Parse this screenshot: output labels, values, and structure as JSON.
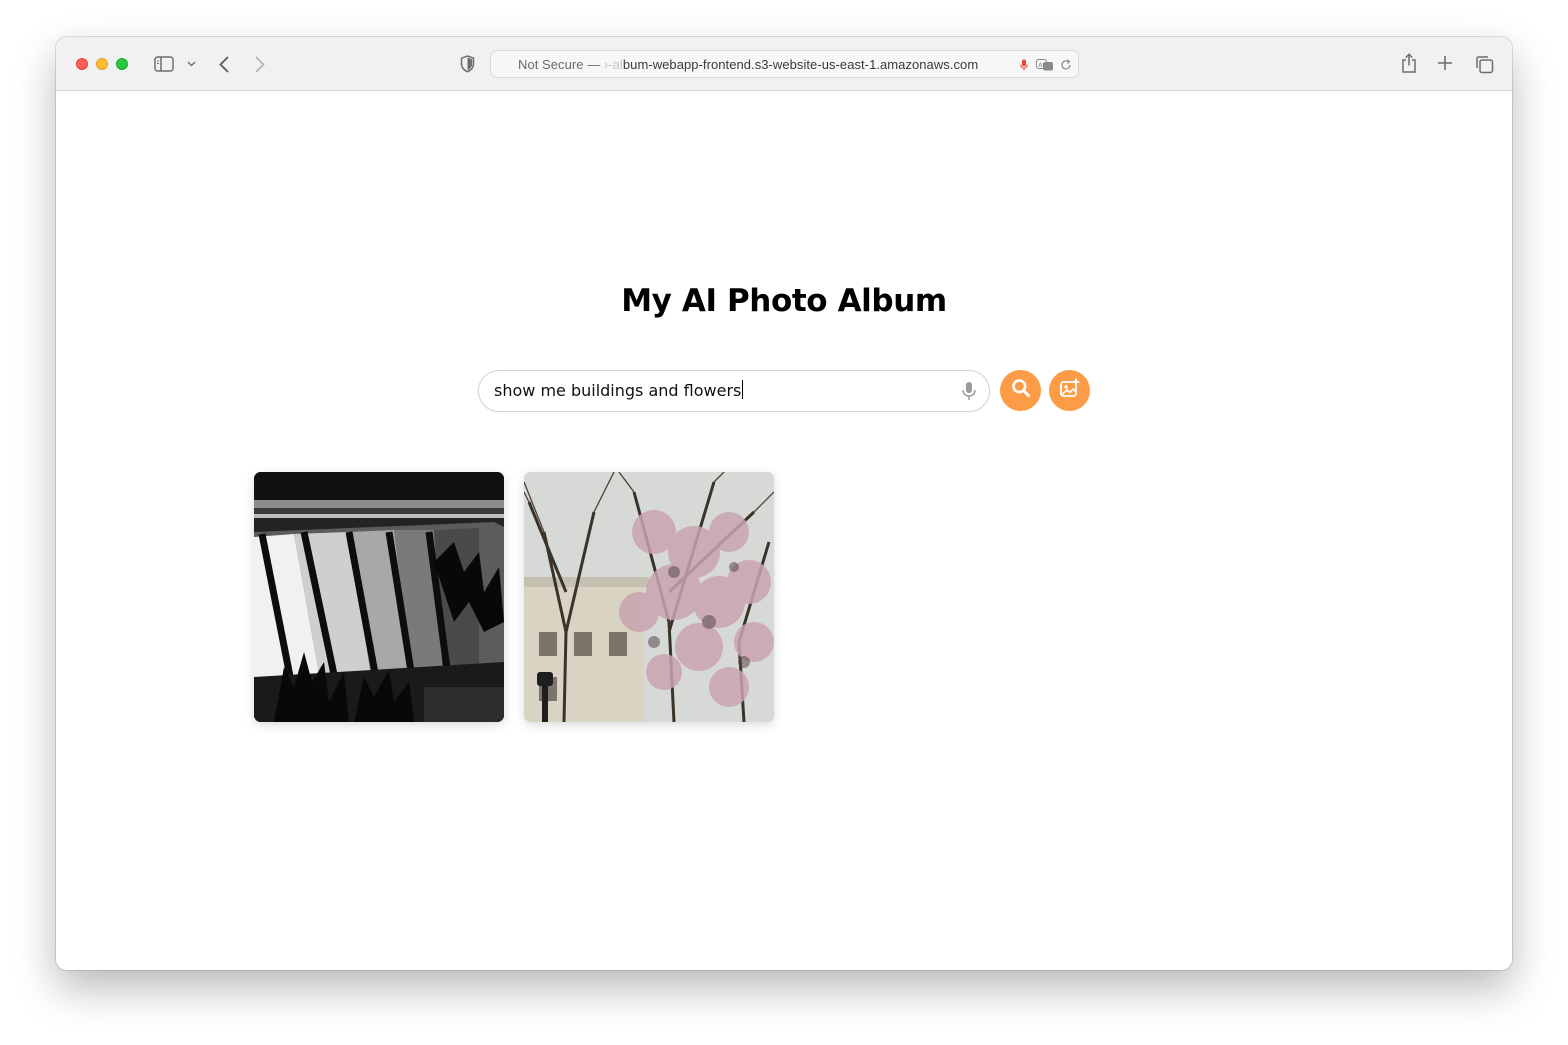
{
  "browser": {
    "url_prefix": "Not Secure —",
    "url_faded": " ›-al",
    "url_main": "bum-webapp-frontend.s3-website-us-east-1.amazonaws.com",
    "icons": [
      "sidebar-icon",
      "chevron-down-icon",
      "back-icon",
      "forward-icon",
      "shield-icon",
      "mic-icon",
      "translate-icon",
      "reload-icon",
      "share-icon",
      "plus-icon",
      "tabs-icon"
    ]
  },
  "page": {
    "title": "My AI Photo Album"
  },
  "search": {
    "value": "show me buildings and flowers",
    "mic_icon": "mic-icon",
    "search_button_icon": "search-icon",
    "upload_button_icon": "image-add-icon",
    "accent_color": "#fc9c47"
  },
  "results": {
    "items": [
      {
        "name": "black-and-white-building-windows-photo"
      },
      {
        "name": "flowering-tree-and-building-photo"
      }
    ]
  }
}
